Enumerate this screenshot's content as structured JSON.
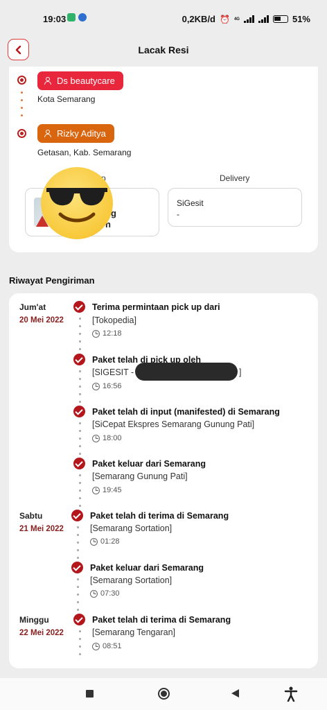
{
  "status_bar": {
    "time": "19:03",
    "network_speed": "0,2KB/d",
    "signal_type": "4G",
    "battery": "51%"
  },
  "header": {
    "title": "Lacak Resi",
    "back_icon": "chevron-left-icon"
  },
  "route": {
    "sender": {
      "name": "Ds beautycare",
      "location": "Kota Semarang",
      "color": "#e8263c"
    },
    "receiver": {
      "name": "Rizky Aditya",
      "location": "Getasan, Kab. Semarang",
      "color": "#d9660f"
    }
  },
  "courier": {
    "pickup_label": "p",
    "pickup_name_line1": "ng",
    "pickup_name_line2": "n",
    "delivery_label": "Delivery",
    "delivery_name": "SiGesit",
    "delivery_value": "-"
  },
  "history": {
    "title": "Riwayat Pengiriman",
    "days": [
      {
        "day": "Jum'at",
        "date": "20 Mei 2022"
      },
      {
        "day": "Sabtu",
        "date": "21 Mei 2022"
      },
      {
        "day": "Minggu",
        "date": "22 Mei 2022"
      }
    ],
    "events": [
      {
        "title": "Terima permintaan pick up dari",
        "detail": "[Tokopedia]",
        "time": "12:18"
      },
      {
        "title": "Paket telah di pick up oleh",
        "detail": "[SIGESIT -",
        "detail_end": "]",
        "time": "16:56"
      },
      {
        "title": "Paket telah di input (manifested) di Semarang",
        "detail": "[SiCepat Ekspres Semarang Gunung Pati]",
        "time": "18:00"
      },
      {
        "title": "Paket keluar dari Semarang",
        "detail": "[Semarang Gunung Pati]",
        "time": "19:45"
      },
      {
        "title": "Paket telah di terima di Semarang",
        "detail": "[Semarang Sortation]",
        "time": "01:28"
      },
      {
        "title": "Paket keluar dari Semarang",
        "detail": "[Semarang Sortation]",
        "time": "07:30"
      },
      {
        "title": "Paket telah di terima di Semarang",
        "detail": "[Semarang Tengaran]",
        "time": "08:51"
      }
    ]
  },
  "colors": {
    "accent": "#b3161b",
    "date_text": "#8a1e1e",
    "timeline_dot": "#e07b3a"
  }
}
